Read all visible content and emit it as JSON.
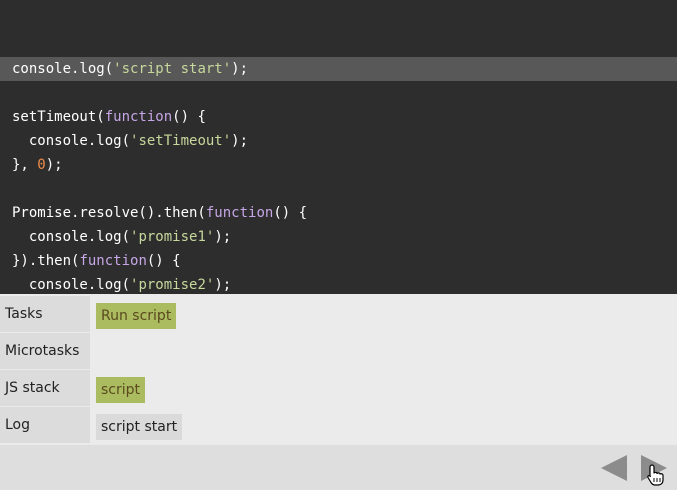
{
  "code": {
    "lines": [
      [
        {
          "t": "console.log(",
          "c": "plain"
        },
        {
          "t": "'script start'",
          "c": "str"
        },
        {
          "t": ");",
          "c": "plain"
        }
      ],
      [],
      [
        {
          "t": "setTimeout(",
          "c": "plain"
        },
        {
          "t": "function",
          "c": "kw"
        },
        {
          "t": "() {",
          "c": "plain"
        }
      ],
      [
        {
          "t": "  console.log(",
          "c": "plain"
        },
        {
          "t": "'setTimeout'",
          "c": "str"
        },
        {
          "t": ");",
          "c": "plain"
        }
      ],
      [
        {
          "t": "}, ",
          "c": "plain"
        },
        {
          "t": "0",
          "c": "num"
        },
        {
          "t": ");",
          "c": "plain"
        }
      ],
      [],
      [
        {
          "t": "Promise.resolve().then(",
          "c": "plain"
        },
        {
          "t": "function",
          "c": "kw"
        },
        {
          "t": "() {",
          "c": "plain"
        }
      ],
      [
        {
          "t": "  console.log(",
          "c": "plain"
        },
        {
          "t": "'promise1'",
          "c": "str"
        },
        {
          "t": ");",
          "c": "plain"
        }
      ],
      [
        {
          "t": "}).then(",
          "c": "plain"
        },
        {
          "t": "function",
          "c": "kw"
        },
        {
          "t": "() {",
          "c": "plain"
        }
      ],
      [
        {
          "t": "  console.log(",
          "c": "plain"
        },
        {
          "t": "'promise2'",
          "c": "str"
        },
        {
          "t": ");",
          "c": "plain"
        }
      ]
    ],
    "highlighted_line": 0
  },
  "rows": {
    "tasks": {
      "label": "Tasks",
      "item": "Run script"
    },
    "microtasks": {
      "label": "Microtasks"
    },
    "js_stack": {
      "label": "JS stack",
      "item": "script"
    },
    "log": {
      "label": "Log",
      "item": "script start"
    }
  },
  "nav": {
    "prev_icon": "triangle-left-icon",
    "next_icon": "triangle-right-icon",
    "cursor_icon": "hand-pointer-icon"
  },
  "colors": {
    "code_bg": "#2d2d2d",
    "highlight_bg": "#585858",
    "string": "#c6d89c",
    "keyword": "#c6a6e6",
    "number": "#f08d49",
    "chip_green": "#aabb60",
    "arrow": "#8c8c8c"
  }
}
